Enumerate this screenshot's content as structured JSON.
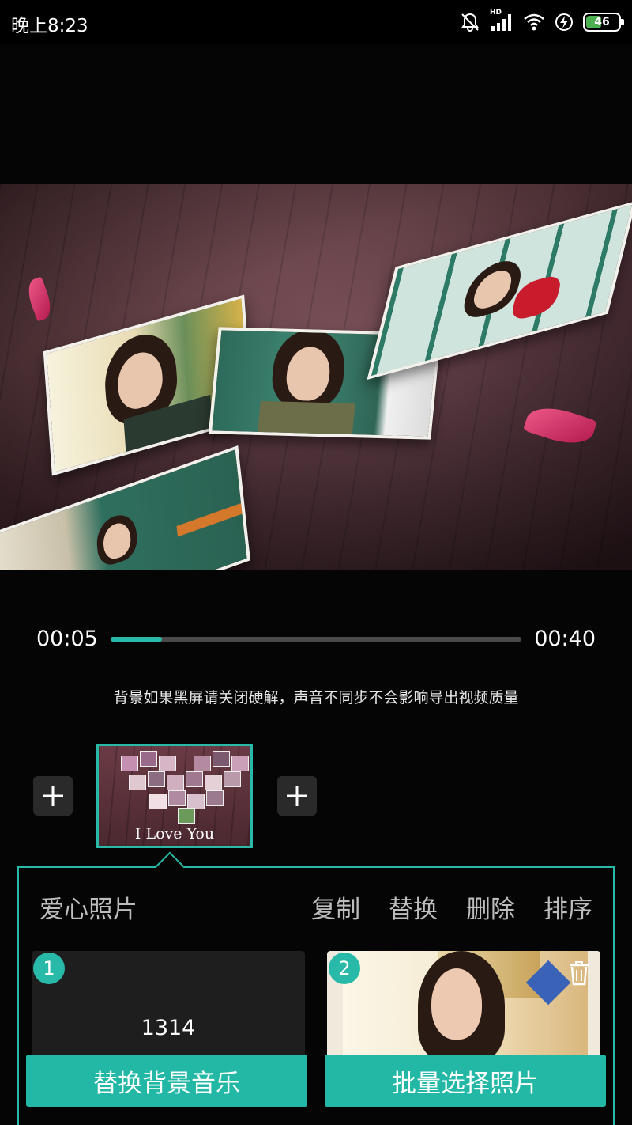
{
  "status_bar": {
    "time": "晚上8:23",
    "battery": "46",
    "network_label": "HD",
    "icons": [
      "mute-bell-icon",
      "hd-signal-icon",
      "wifi-icon",
      "charging-icon",
      "battery-icon"
    ]
  },
  "player": {
    "current_time": "00:05",
    "total_time": "00:40",
    "progress": 0.125,
    "accent_color": "#29b9a8"
  },
  "hint": "背景如果黑屏请关闭硬解，声音不同步不会影响导出视频质量",
  "clip_strip": {
    "selected_clip_caption": "I Love You"
  },
  "panel": {
    "title": "爱心照片",
    "actions": [
      "复制",
      "替换",
      "删除",
      "排序"
    ],
    "slots": [
      {
        "index": "1",
        "text": "1314"
      },
      {
        "index": "2"
      }
    ],
    "buttons": {
      "replace_music": "替换背景音乐",
      "batch_select_photos": "批量选择照片"
    }
  }
}
